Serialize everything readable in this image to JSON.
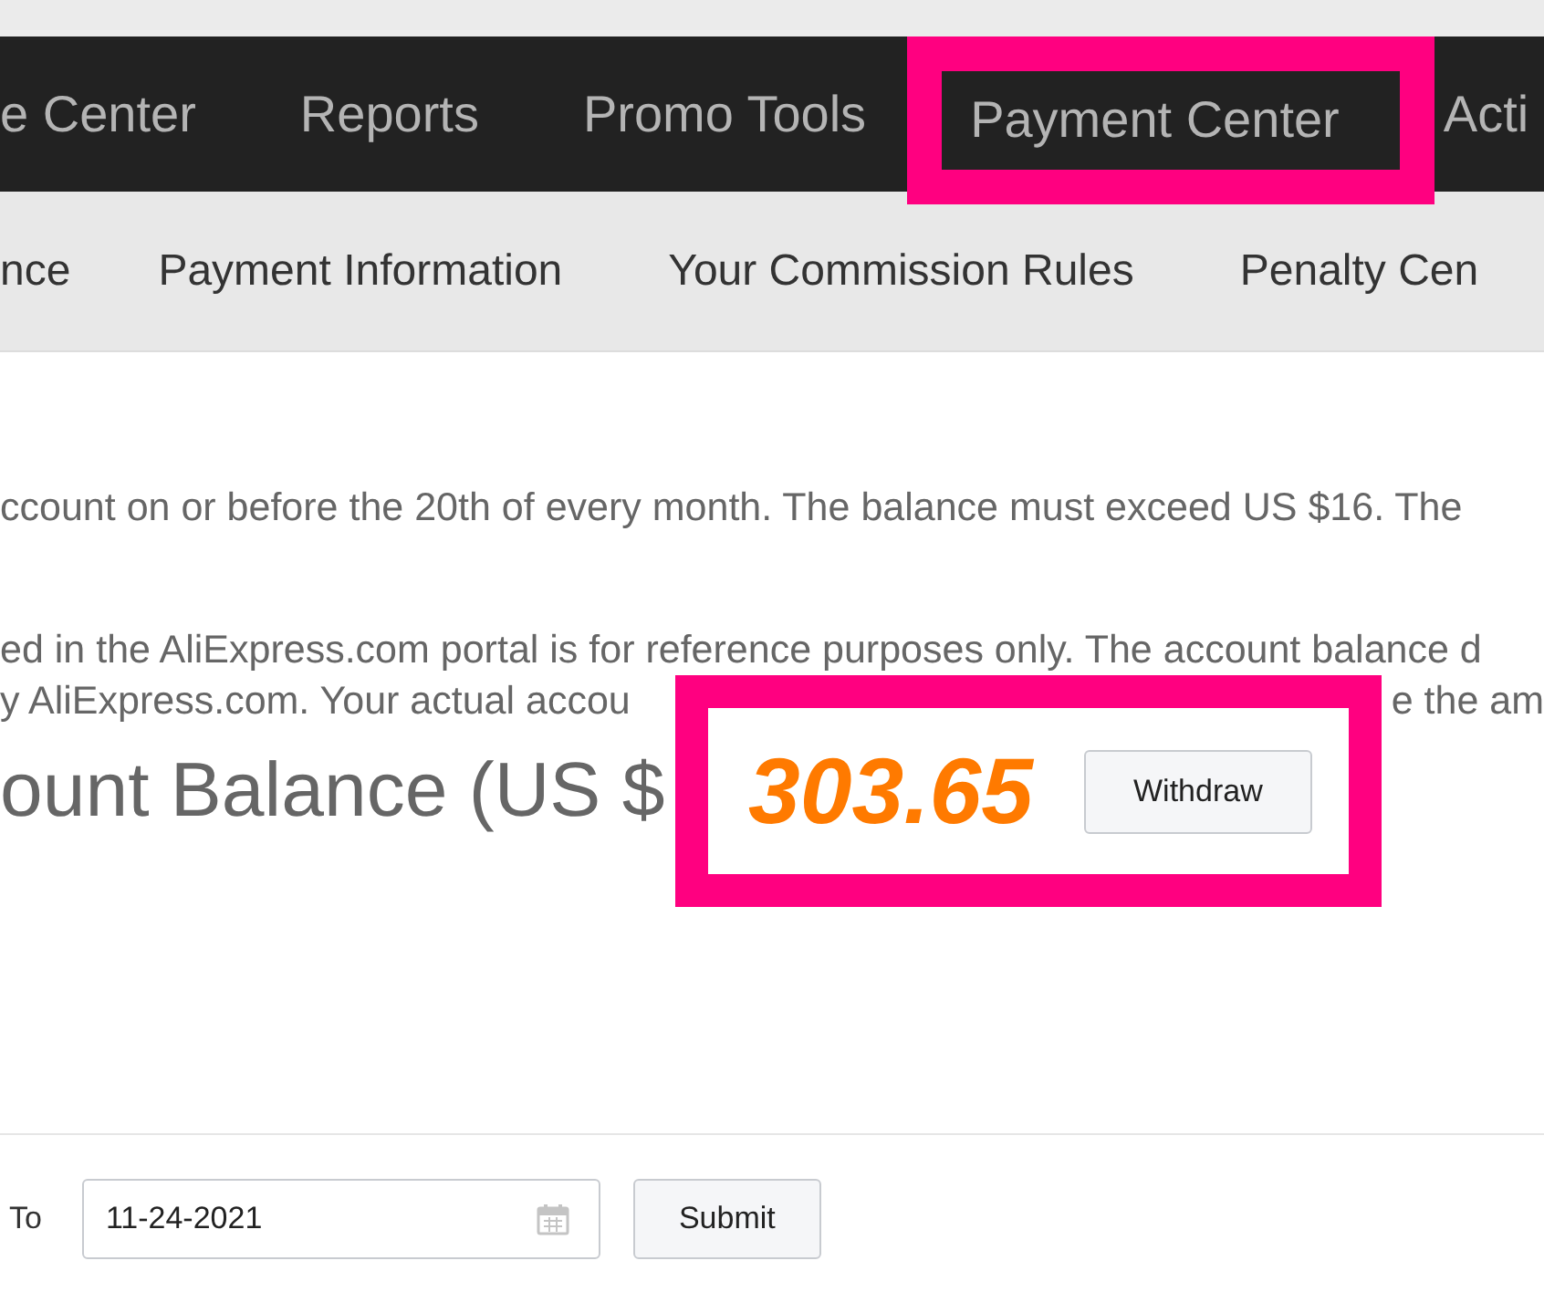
{
  "main_nav": [
    {
      "label": "e Center",
      "selected": false
    },
    {
      "label": "Reports",
      "selected": false
    },
    {
      "label": "Promo Tools",
      "selected": false
    },
    {
      "label": "Payment Center",
      "selected": true
    },
    {
      "label": "Acti",
      "selected": false
    }
  ],
  "sub_nav": [
    {
      "label": "nce"
    },
    {
      "label": "Payment Information"
    },
    {
      "label": "Your Commission Rules"
    },
    {
      "label": "Penalty Cen"
    }
  ],
  "notice": "ccount on or before the 20th of every month. The balance must exceed US $16. The",
  "disclaimer": {
    "line_1": "ed in the AliExpress.com portal is for reference purposes only. The account balance d",
    "line_2_left": "y AliExpress.com. Your actual accou",
    "line_2_right": "e the am"
  },
  "balance": {
    "label": "ount Balance (US $",
    "amount": "303.65",
    "button": "Withdraw"
  },
  "filter": {
    "to_label": "To",
    "to_value": "11-24-2021",
    "submit": "Submit"
  }
}
